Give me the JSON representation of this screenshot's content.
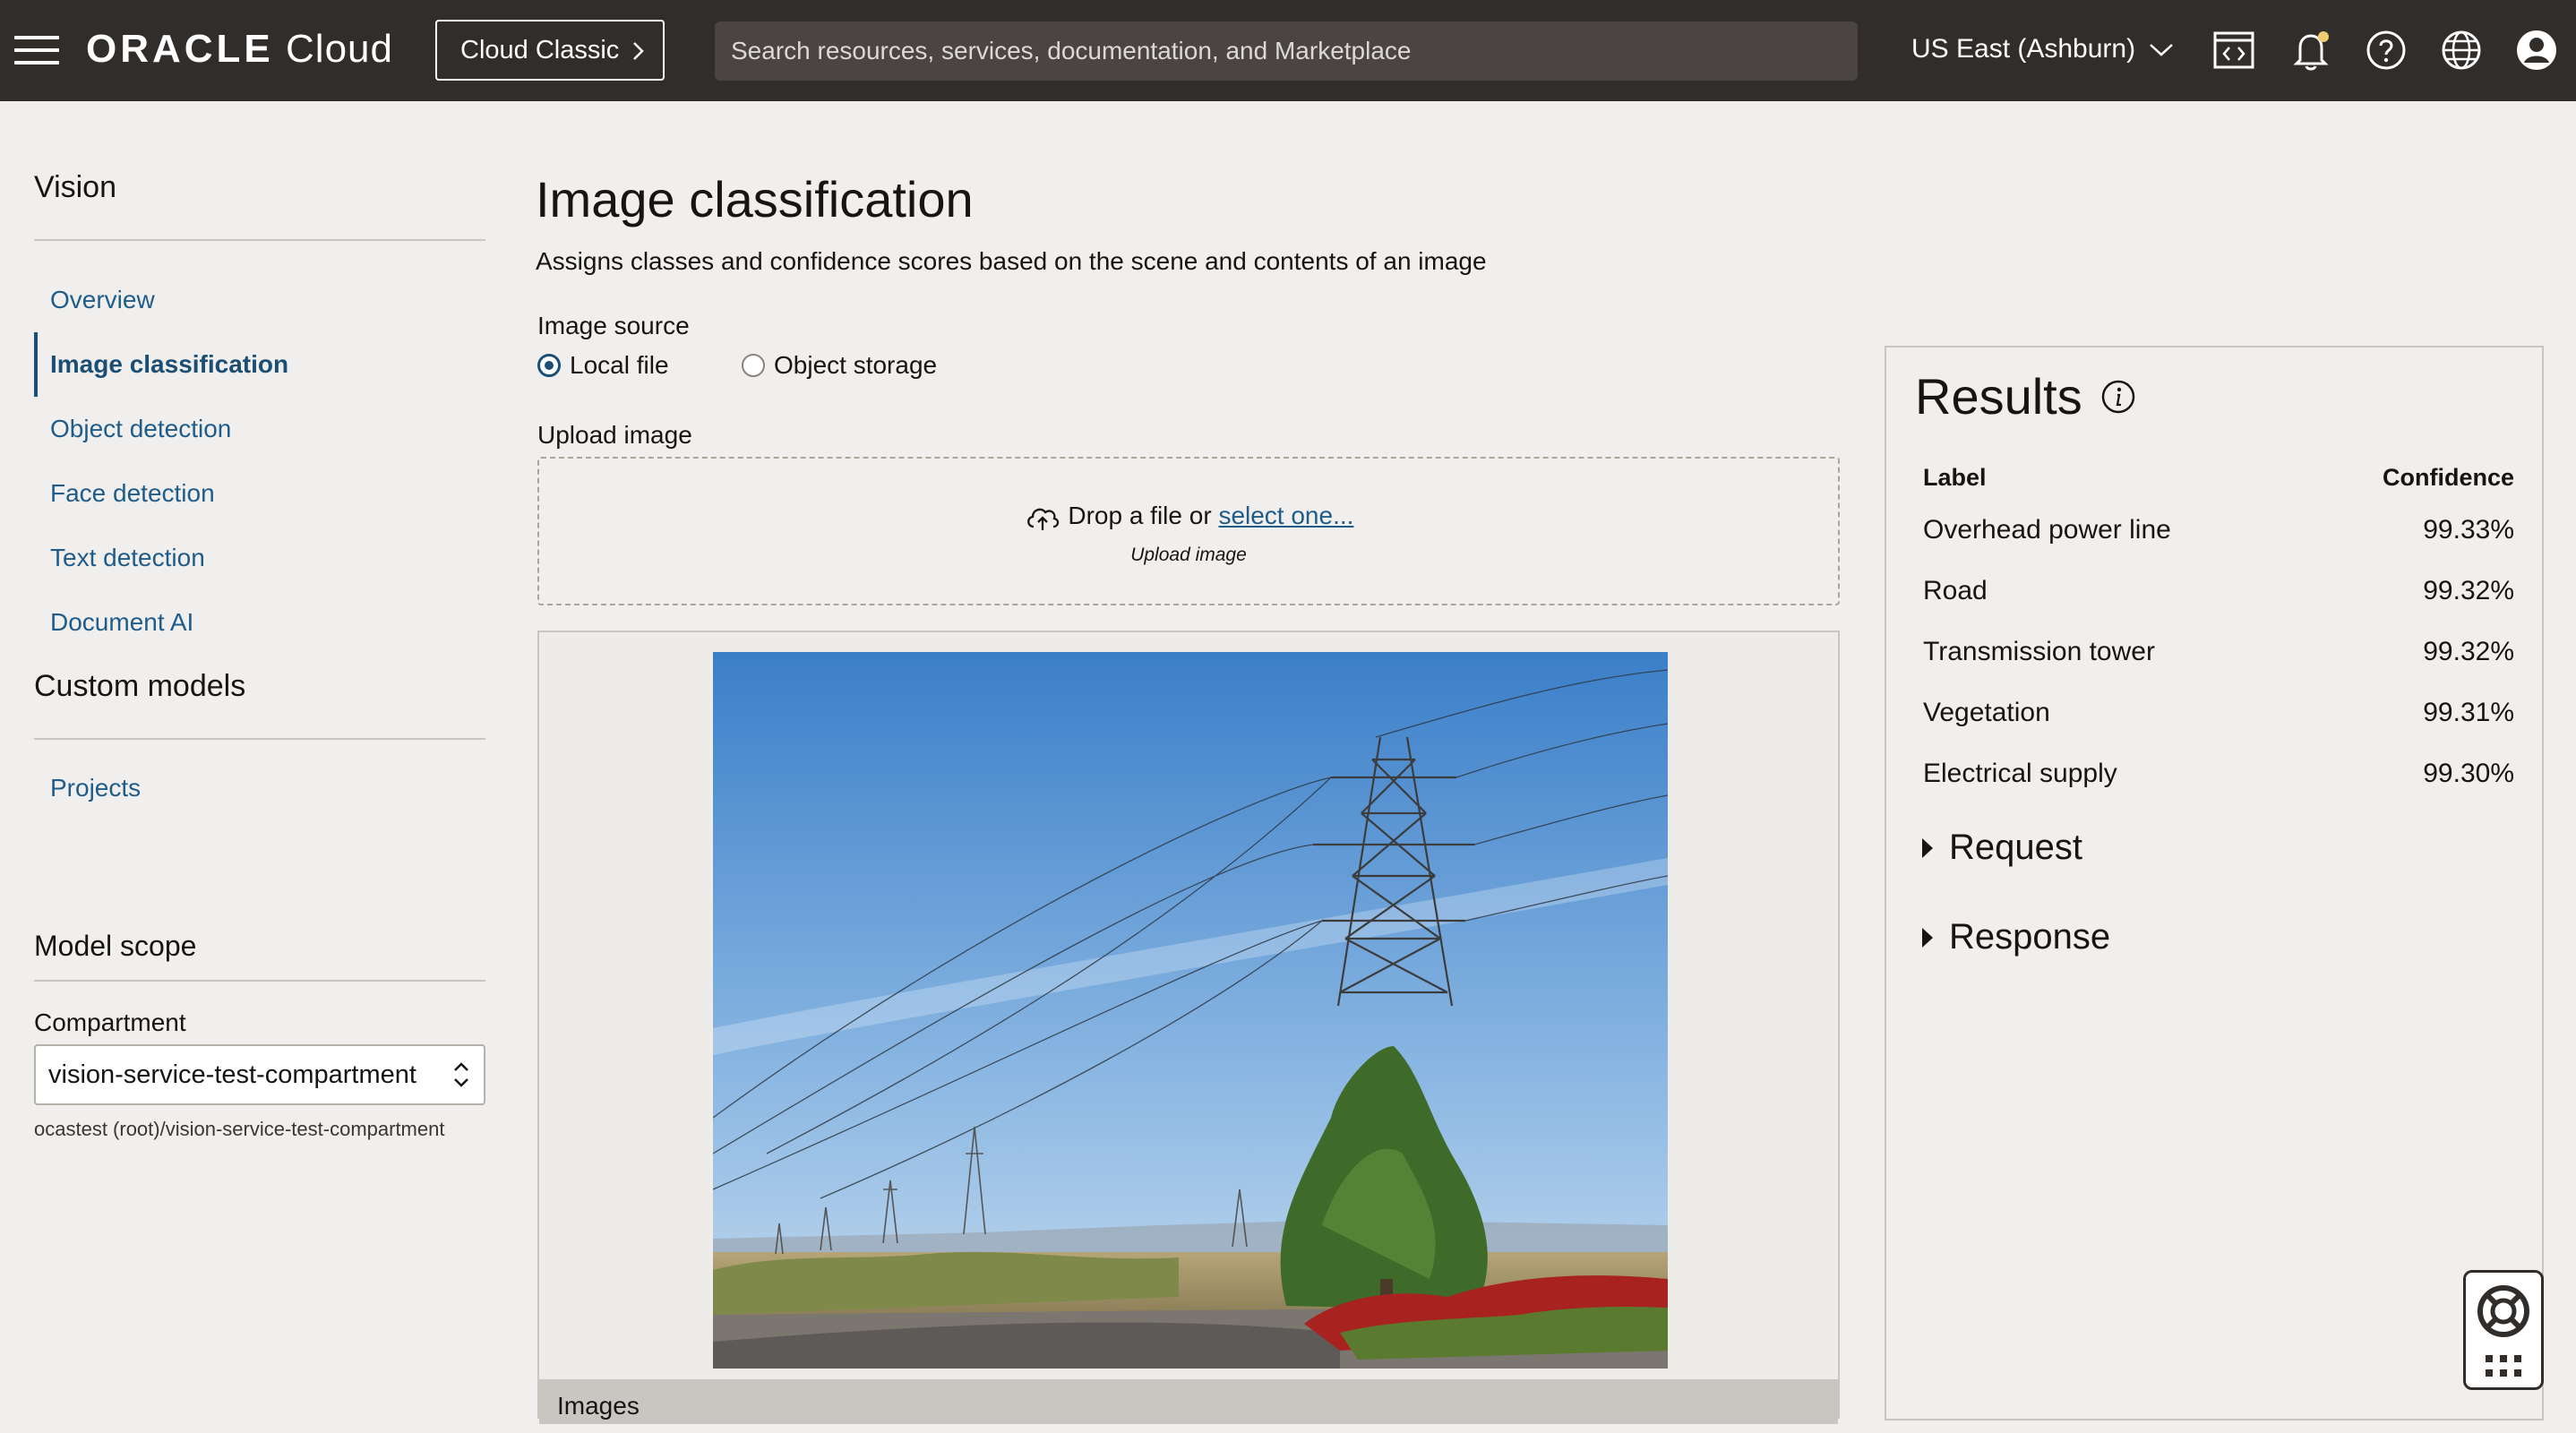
{
  "header": {
    "brand_bold": "ORACLE",
    "brand_light": "Cloud",
    "classic_button": "Cloud Classic",
    "search_placeholder": "Search resources, services, documentation, and Marketplace",
    "region": "US East (Ashburn)",
    "icons": [
      "menu-icon",
      "code-editor-icon",
      "bell-icon",
      "help-icon",
      "globe-icon",
      "user-icon"
    ]
  },
  "sidebar": {
    "heading": "Vision",
    "items": [
      {
        "label": "Overview",
        "active": false
      },
      {
        "label": "Image classification",
        "active": true
      },
      {
        "label": "Object detection",
        "active": false
      },
      {
        "label": "Face detection",
        "active": false
      },
      {
        "label": "Text detection",
        "active": false
      },
      {
        "label": "Document AI",
        "active": false
      }
    ],
    "custom_heading": "Custom models",
    "custom_items": [
      {
        "label": "Projects"
      }
    ]
  },
  "scope": {
    "title": "Model scope",
    "compartment_label": "Compartment",
    "compartment_value": "vision-service-test-compartment",
    "compartment_path": "ocastest (root)/vision-service-test-compartment"
  },
  "main": {
    "title": "Image classification",
    "description": "Assigns classes and confidence scores based on the scene and contents of an image",
    "source_label": "Image source",
    "source_options": [
      {
        "label": "Local file",
        "selected": true
      },
      {
        "label": "Object storage",
        "selected": false
      }
    ],
    "upload_label": "Upload image",
    "drop_text": "Drop a file or",
    "drop_link": "select one...",
    "drop_sub": "Upload image",
    "images_tab": "Images"
  },
  "results": {
    "title": "Results",
    "col_label": "Label",
    "col_confidence": "Confidence",
    "rows": [
      {
        "label": "Overhead power line",
        "confidence": "99.33%"
      },
      {
        "label": "Road",
        "confidence": "99.32%"
      },
      {
        "label": "Transmission tower",
        "confidence": "99.32%"
      },
      {
        "label": "Vegetation",
        "confidence": "99.31%"
      },
      {
        "label": "Electrical supply",
        "confidence": "99.30%"
      }
    ],
    "request_label": "Request",
    "response_label": "Response"
  },
  "colors": {
    "header_bg": "#312d2a",
    "link": "#1f5c8a",
    "active": "#1a4e75",
    "page_bg": "#f1efed"
  }
}
